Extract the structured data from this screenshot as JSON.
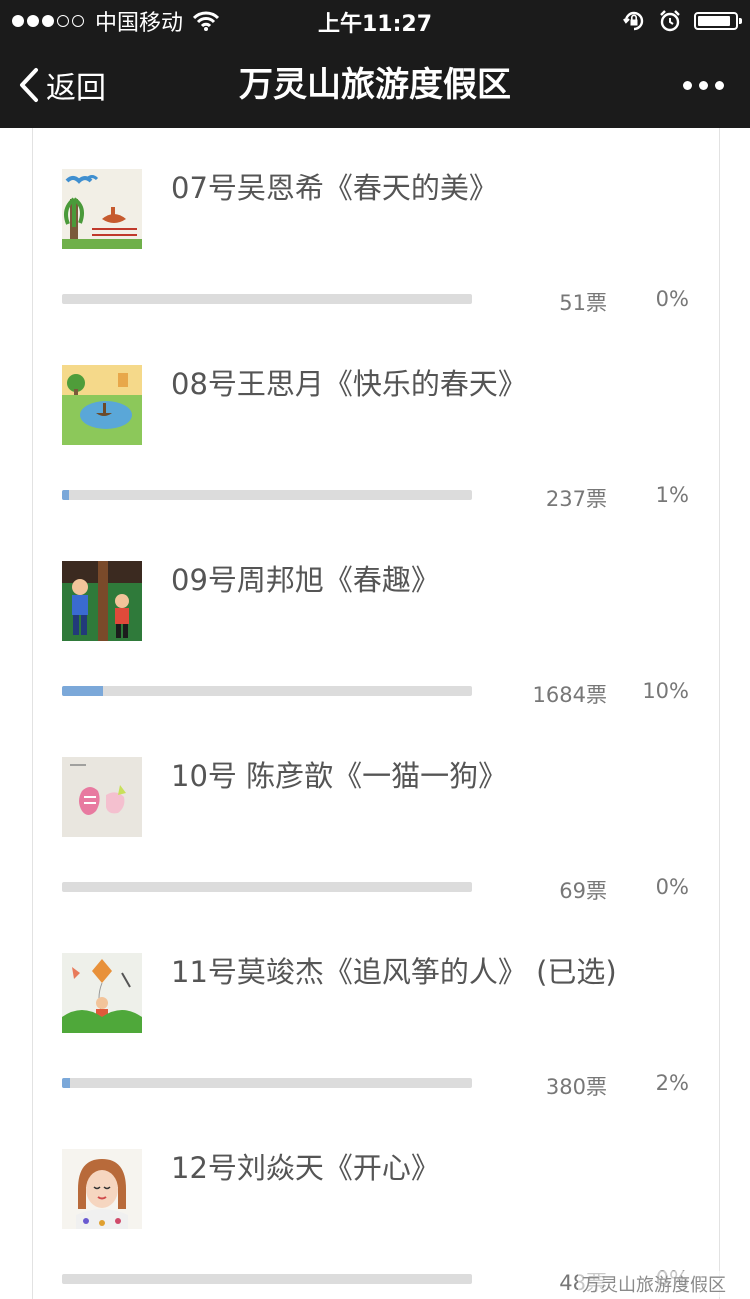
{
  "status_bar": {
    "signal_dots": [
      true,
      true,
      true,
      false,
      false
    ],
    "carrier": "中国移动",
    "time": "上午11:27",
    "icons": [
      "wifi-icon",
      "rotation-lock-icon",
      "alarm-icon",
      "battery-icon"
    ]
  },
  "nav": {
    "back_label": "返回",
    "title": "万灵山旅游度假区",
    "more_icon": "more-dots-icon"
  },
  "colors": {
    "bar_fill": "#7ba8d9",
    "bar_track": "#dcdcdc",
    "nav_bg": "#1b1b1b"
  },
  "items": [
    {
      "name": "07号吴恩希《春天的美》",
      "votes": "51票",
      "percent": "0%",
      "percent_value": 0
    },
    {
      "name": "08号王思月《快乐的春天》",
      "votes": "237票",
      "percent": "1%",
      "percent_value": 1
    },
    {
      "name": "09号周邦旭《春趣》",
      "votes": "1684票",
      "percent": "10%",
      "percent_value": 10
    },
    {
      "name": "10号 陈彦歆《一猫一狗》",
      "votes": "69票",
      "percent": "0%",
      "percent_value": 0
    },
    {
      "name": "11号莫竣杰《追风筝的人》 (已选)",
      "votes": "380票",
      "percent": "2%",
      "percent_value": 2
    },
    {
      "name": "12号刘焱天《开心》",
      "votes": "48票",
      "percent": "0%",
      "percent_value": 0
    }
  ],
  "watermark": "万灵山旅游度假区"
}
